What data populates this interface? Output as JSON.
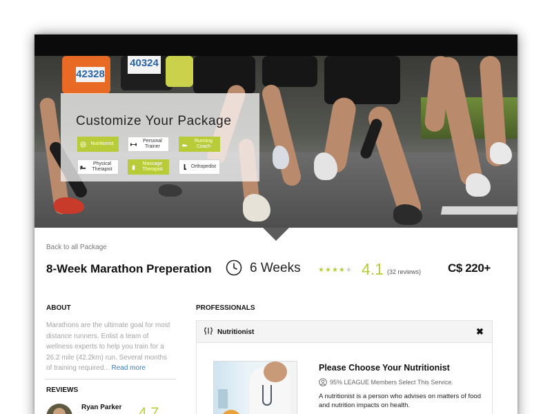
{
  "hero": {
    "customize_title": "Customize Your Package",
    "bib_numbers": [
      "42328",
      "40324"
    ],
    "options": [
      {
        "label": "Nutritionist",
        "selected": true,
        "icon": "brain-icon"
      },
      {
        "label": "Personal Trainer",
        "selected": false,
        "icon": "dumbbell-icon"
      },
      {
        "label": "Running Coach",
        "selected": true,
        "icon": "running-shoe-icon"
      },
      {
        "label": "Physical Therapist",
        "selected": false,
        "icon": "bed-icon"
      },
      {
        "label": "Massage Therapist",
        "selected": true,
        "icon": "hand-icon"
      },
      {
        "label": "Orthopedist",
        "selected": false,
        "icon": "leg-icon"
      }
    ]
  },
  "package": {
    "back_link": "Back to all Package",
    "title": "8-Week Marathon Preperation",
    "duration": "6 Weeks",
    "stars_filled": 4,
    "stars_total": 5,
    "rating": "4.1",
    "reviews": "(32 reviews)",
    "price": "C$ 220+"
  },
  "about": {
    "heading": "ABOUT",
    "text": "Marathons are the ultimate goal for most distance runners. Enlist a team of wellness experts to help you train for a 26.2 mile (42.2km) run. Several months of training required...",
    "read_more": "Read more"
  },
  "reviews": {
    "heading": "REVIEWS",
    "items": [
      {
        "name": "Ryan Parker",
        "score": "4.7"
      }
    ]
  },
  "professionals": {
    "heading": "PROFESSIONALS",
    "selected_label": "Nutritionist",
    "choose_title": "Please Choose Your Nutritionist",
    "member_stat": "95% LEAGUE Members Select This Service.",
    "description": "A nutritionist is a person who advises on matters of food and nutrition impacts on health.",
    "close_symbol": "✖"
  },
  "colors": {
    "accent": "#b8cc3a",
    "link": "#3d7ebf",
    "topbar": "#0b0b0b"
  }
}
